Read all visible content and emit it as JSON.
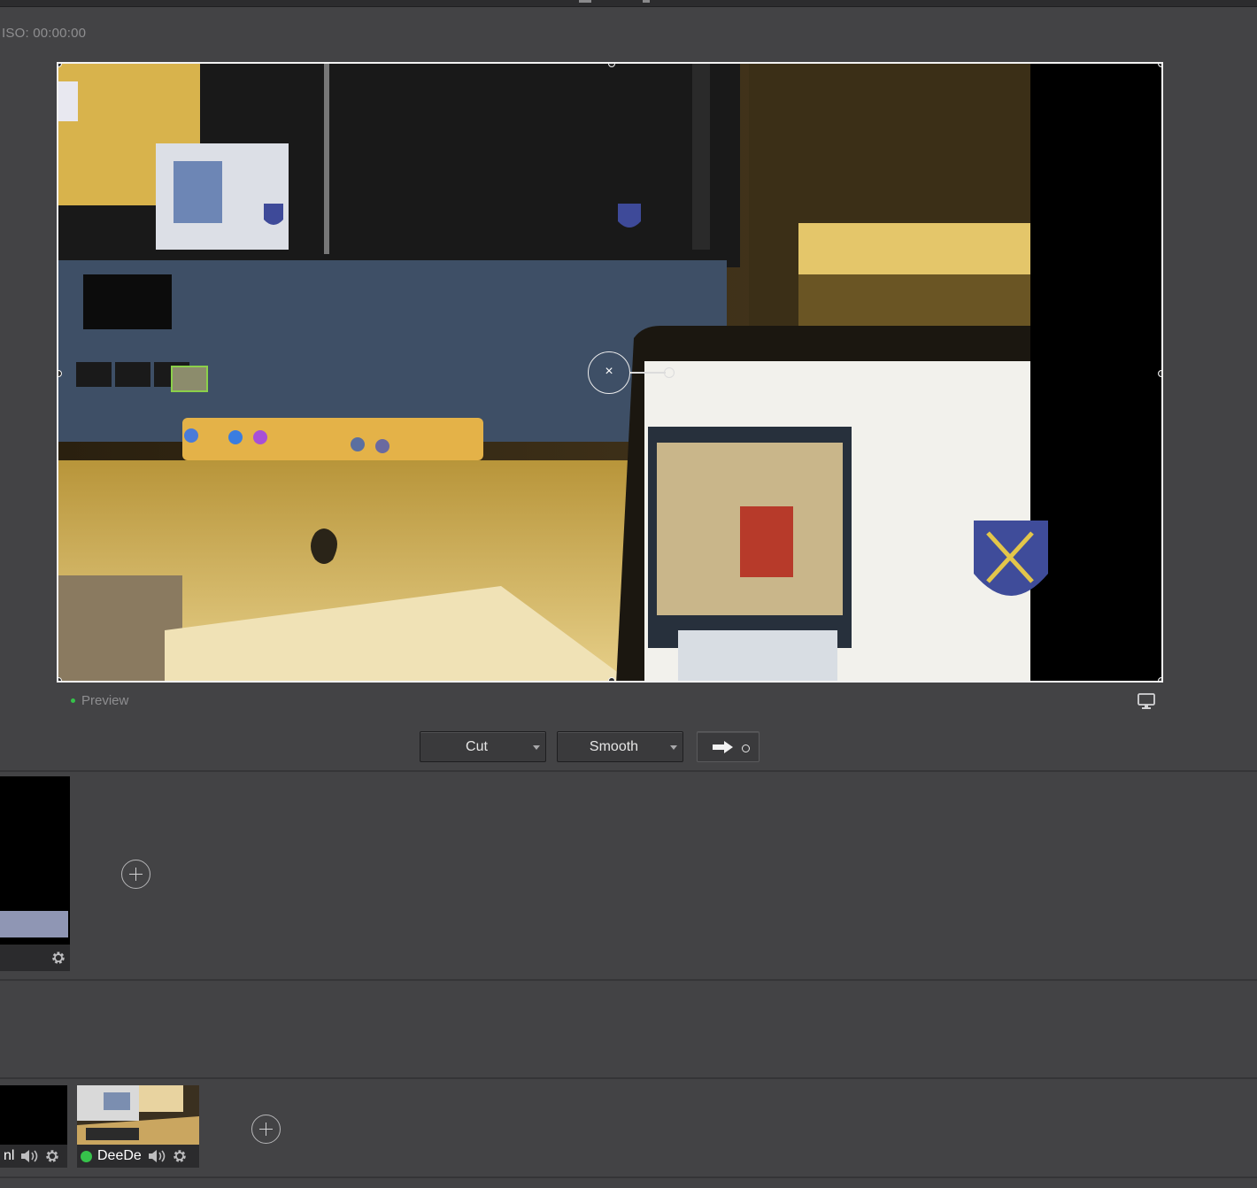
{
  "recording": {
    "iso_label": "ISO:",
    "iso_time": "00:00:00"
  },
  "preview": {
    "label": "Preview",
    "status_color": "#35c24a",
    "monitor_icon": "monitor-icon"
  },
  "transition": {
    "type_label": "Cut",
    "easing_label": "Smooth",
    "take_icon": "arrow-right-icon"
  },
  "scenes": {
    "add_label": "add-scene",
    "tiles": [
      {
        "name": "",
        "icons": [
          "gear-icon"
        ]
      }
    ]
  },
  "sources": {
    "add_label": "add-source",
    "tiles": [
      {
        "name": "nl",
        "live": false,
        "icons": [
          "speaker-icon",
          "gear-icon"
        ]
      },
      {
        "name": "DeeDe",
        "live": true,
        "live_color": "#36c24b",
        "icons": [
          "speaker-icon",
          "gear-icon"
        ]
      }
    ]
  }
}
